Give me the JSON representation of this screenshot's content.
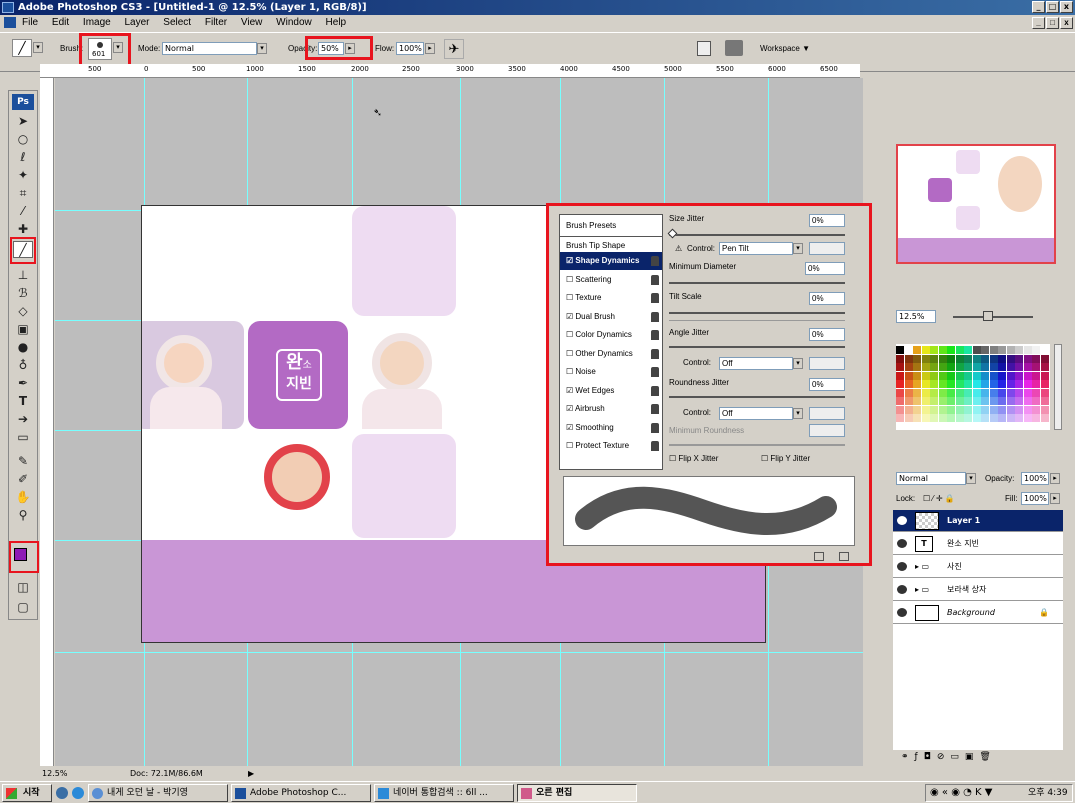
{
  "window": {
    "title": "Adobe Photoshop CS3 - [Untitled-1 @ 12.5% (Layer 1, RGB/8)]",
    "controls": [
      "_",
      "□",
      "x"
    ]
  },
  "menu": [
    "File",
    "Edit",
    "Image",
    "Layer",
    "Select",
    "Filter",
    "View",
    "Window",
    "Help"
  ],
  "options": {
    "brush_label": "Brush:",
    "brush_size": "601",
    "mode_label": "Mode:",
    "mode_value": "Normal",
    "opacity_label": "Opacity:",
    "opacity_value": "50%",
    "flow_label": "Flow:",
    "flow_value": "100%",
    "workspace_label": "Workspace ▼"
  },
  "ruler_ticks": [
    "500",
    "0",
    "500",
    "1000",
    "1500",
    "2000",
    "2500",
    "3000",
    "3500",
    "4000",
    "4500",
    "5000",
    "5500",
    "6000",
    "6500"
  ],
  "brush_panel": {
    "items": [
      {
        "label": "Brush Presets",
        "checked": null,
        "selected": false
      },
      {
        "label": "Brush Tip Shape",
        "checked": null,
        "selected": false
      },
      {
        "label": "Shape Dynamics",
        "checked": true,
        "selected": true
      },
      {
        "label": "Scattering",
        "checked": false,
        "selected": false
      },
      {
        "label": "Texture",
        "checked": false,
        "selected": false
      },
      {
        "label": "Dual Brush",
        "checked": true,
        "selected": false
      },
      {
        "label": "Color Dynamics",
        "checked": false,
        "selected": false
      },
      {
        "label": "Other Dynamics",
        "checked": false,
        "selected": false
      },
      {
        "label": "Noise",
        "checked": false,
        "selected": false
      },
      {
        "label": "Wet Edges",
        "checked": true,
        "selected": false
      },
      {
        "label": "Airbrush",
        "checked": true,
        "selected": false
      },
      {
        "label": "Smoothing",
        "checked": true,
        "selected": false
      },
      {
        "label": "Protect Texture",
        "checked": false,
        "selected": false
      }
    ],
    "size_jitter_label": "Size Jitter",
    "size_jitter_value": "0%",
    "control1_label": "Control:",
    "control1_value": "Pen Tilt",
    "min_diameter_label": "Minimum Diameter",
    "min_diameter_value": "0%",
    "tilt_scale_label": "Tilt Scale",
    "tilt_scale_value": "0%",
    "angle_jitter_label": "Angle Jitter",
    "angle_jitter_value": "0%",
    "control2_label": "Control:",
    "control2_value": "Off",
    "roundness_jitter_label": "Roundness Jitter",
    "roundness_jitter_value": "0%",
    "control3_label": "Control:",
    "control3_value": "Off",
    "min_roundness_label": "Minimum Roundness",
    "flip_x_label": "Flip X Jitter",
    "flip_y_label": "Flip Y Jitter"
  },
  "canvas_text": {
    "logo_line1": "완",
    "logo_small": "소",
    "logo_line2": "지빈"
  },
  "navigator": {
    "zoom": "12.5%"
  },
  "layers": {
    "mode": "Normal",
    "opacity_label": "Opacity:",
    "opacity_value": "100%",
    "lock_label": "Lock:",
    "fill_label": "Fill:",
    "fill_value": "100%",
    "rows": [
      {
        "name": "Layer 1",
        "selected": true
      },
      {
        "name": "완소 지빈",
        "selected": false
      },
      {
        "name": "사진",
        "selected": false
      },
      {
        "name": "보라색 상자",
        "selected": false
      },
      {
        "name": "Background",
        "selected": false
      }
    ]
  },
  "status": {
    "zoom": "12.5%",
    "doc": "Doc: 72.1M/86.6M"
  },
  "taskbar": {
    "start": "시작",
    "tasks": [
      "내게 오던 날 - 박기영",
      "Adobe Photoshop C...",
      "네이버 통합검색 :: 6ll ...",
      "오른 편집"
    ],
    "clock": "오후 4:39"
  },
  "colors": {
    "purple": "#c996d6",
    "light_purple": "#eedcf2",
    "deep_purple": "#b36ac4",
    "foreground": "#8e1bb5"
  }
}
